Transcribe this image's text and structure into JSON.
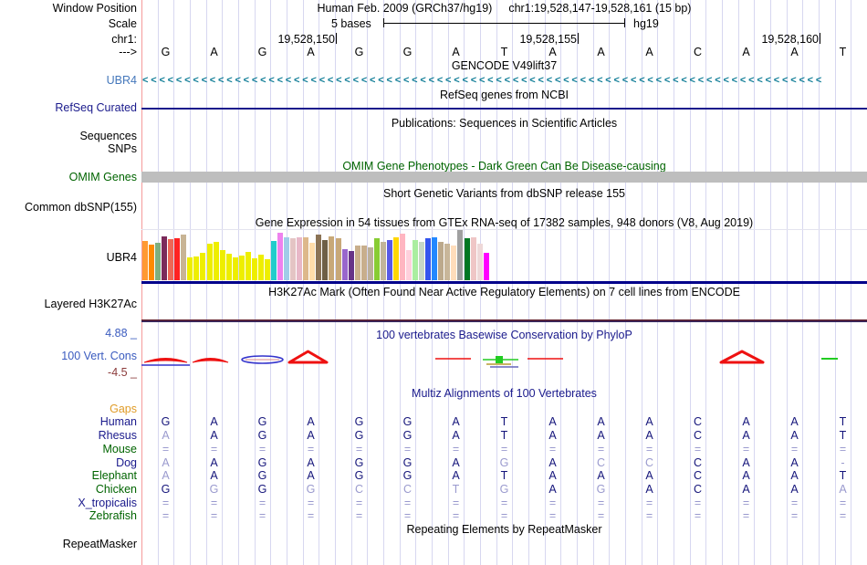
{
  "header": {
    "window_position_label": "Window Position",
    "assembly_title": "Human Feb. 2009 (GRCh37/hg19)",
    "position_title": "chr1:19,528,147-19,528,161 (15 bp)",
    "scale_label": "Scale",
    "scale_bar_text": "5 bases",
    "assembly_short": "hg19",
    "chrom_label": "chr1:",
    "strand_label": "--->",
    "coordinate_ticks": [
      "19,528,150",
      "19,528,155",
      "19,528,160"
    ],
    "sequence": [
      "G",
      "A",
      "G",
      "A",
      "G",
      "G",
      "A",
      "T",
      "A",
      "A",
      "A",
      "C",
      "A",
      "A",
      "T"
    ]
  },
  "tracks": {
    "gencode": {
      "title": "GENCODE V49lift37",
      "gene_label": "UBR4",
      "strand_direction": "left"
    },
    "refseq": {
      "title": "RefSeq genes from NCBI",
      "label": "RefSeq Curated"
    },
    "publications": {
      "title": "Publications: Sequences in Scientific Articles",
      "label_sequences": "Sequences",
      "label_snps": "SNPs"
    },
    "omim": {
      "title": "OMIM Gene Phenotypes - Dark Green Can Be Disease-causing",
      "label": "OMIM Genes"
    },
    "dbsnp": {
      "title": "Short Genetic Variants from dbSNP release 155",
      "label": "Common dbSNP(155)"
    },
    "gtex": {
      "title": "Gene Expression in 54 tissues from GTEx RNA-seq of 17382 samples, 948 donors (V8, Aug 2019)",
      "label": "UBR4"
    },
    "h3k27ac": {
      "title": "H3K27Ac Mark (Often Found Near Active Regulatory Elements) on 7 cell lines from ENCODE",
      "label": "Layered H3K27Ac"
    },
    "phylop": {
      "title": "100 vertebrates Basewise Conservation by PhyloP",
      "label": "100 Vert. Cons",
      "max_tick": "4.88 _",
      "min_tick": "-4.5 _"
    },
    "multiz": {
      "title": "Multiz Alignments of 100 Vertebrates"
    },
    "repeatmasker": {
      "title": "Repeating Elements by RepeatMasker",
      "label": "RepeatMasker"
    }
  },
  "colors": {
    "grid": "#d7d7f0",
    "guide_red": "#f59a9a",
    "gencode_arrows": "#0e7c96",
    "gene_label_blue": "#4477bb",
    "refseq_navy": "#1a1a8c",
    "omim_green": "#006400",
    "omim_bar_gray": "#bebebe",
    "gtex_baseline_navy": "#00008b",
    "h3k27ac_line_top": "#6e2020",
    "h3k27ac_line_bottom": "#28286e",
    "phylop_pos_red": "#ee1111",
    "phylop_neg_blue": "#3333cc",
    "phylop_green": "#22cc22",
    "aln_dark": "#15157b",
    "aln_dim": "#9a9ace",
    "gaps_orange": "#e09c28"
  },
  "chart_data": [
    {
      "type": "bar",
      "title": "Gene Expression in 54 tissues from GTEx RNA-seq of 17382 samples, 948 donors (V8, Aug 2019)",
      "series": "UBR4 expression per GTEx tissue (left to right as drawn)",
      "ylabel": "relative expression (bar height, 0-1 of panel)",
      "values": [
        0.78,
        0.71,
        0.75,
        0.87,
        0.82,
        0.84,
        0.91,
        0.45,
        0.47,
        0.55,
        0.73,
        0.76,
        0.6,
        0.53,
        0.45,
        0.49,
        0.56,
        0.44,
        0.51,
        0.42,
        0.78,
        0.95,
        0.85,
        0.84,
        0.85,
        0.85,
        0.75,
        0.91,
        0.8,
        0.87,
        0.84,
        0.62,
        0.58,
        0.69,
        0.69,
        0.65,
        0.84,
        0.76,
        0.8,
        0.85,
        0.93,
        0.6,
        0.8,
        0.76,
        0.84,
        0.85,
        0.76,
        0.73,
        0.69,
        1.0,
        0.84,
        0.85,
        0.73,
        0.55
      ],
      "colors": [
        "#ff9933",
        "#ff8a00",
        "#7faf7f",
        "#7b2b5b",
        "#ee6655",
        "#ff2222",
        "#c8b494",
        "#eeee00",
        "#eeee00",
        "#eeee00",
        "#eeee00",
        "#eeee00",
        "#eeee00",
        "#eeee00",
        "#eeee00",
        "#eeee00",
        "#eeee00",
        "#eeee00",
        "#eeee00",
        "#eeee00",
        "#22cccc",
        "#ee82ee",
        "#a0cce8",
        "#e4c4c4",
        "#e8b8c8",
        "#ddb88a",
        "#ffddaa",
        "#8b7355",
        "#6e5f46",
        "#c8a878",
        "#c8a878",
        "#9966cc",
        "#663388",
        "#c8ae8c",
        "#c8ae8c",
        "#bcb09a",
        "#88cc33",
        "#c2b49a",
        "#5959e6",
        "#ffd700",
        "#ffb6c1",
        "#ffd0dc",
        "#aaeea0",
        "#c6d8c6",
        "#3355ee",
        "#2288ff",
        "#bca98c",
        "#c8b69a",
        "#ffddbb",
        "#a0a0a0",
        "#007722",
        "#efc6c6",
        "#eed8d8",
        "#ff00ff"
      ]
    },
    {
      "type": "area",
      "title": "100 vertebrates Basewise Conservation by PhyloP",
      "ylim": [
        -4.5,
        4.88
      ],
      "features": [
        {
          "base": 1,
          "shape": "hump",
          "color": "red",
          "x1": 158,
          "x2": 205,
          "underline": "blue"
        },
        {
          "base": 2,
          "shape": "hump",
          "color": "red",
          "x1": 211,
          "x2": 250
        },
        {
          "base": 3,
          "shape": "ellipse",
          "color": "blue",
          "x1": 265,
          "x2": 310
        },
        {
          "base": 4,
          "shape": "triangle",
          "color": "red",
          "x1": 317,
          "x2": 358
        },
        {
          "base": 7,
          "shape": "line",
          "color": "red",
          "x1": 477,
          "x2": 516
        },
        {
          "base": 8,
          "shape": "line-with-box",
          "color": "green",
          "x1": 529,
          "x2": 568,
          "box_x": 543
        },
        {
          "base": 9,
          "shape": "line",
          "color": "red",
          "x1": 578,
          "x2": 617
        },
        {
          "base": 13,
          "shape": "triangle",
          "color": "red",
          "x1": 790,
          "x2": 836
        },
        {
          "base": 15,
          "shape": "dash",
          "color": "green",
          "x1": 900,
          "x2": 918
        }
      ]
    },
    {
      "type": "table",
      "title": "Multiz Alignments of 100 Vertebrates",
      "note": "lowercase = dimmed letter, '=' = unaligning double-dash, '-' = gap",
      "rows": [
        {
          "name": "Gaps",
          "name_color": "orange",
          "cells": ""
        },
        {
          "name": "Human",
          "name_color": "navy",
          "cells": "GAGAGGATAAACAAT"
        },
        {
          "name": "Rhesus",
          "name_color": "navy",
          "cells": "aAGAGGATAAACAAT"
        },
        {
          "name": "Mouse",
          "name_color": "green",
          "cells": "==============="
        },
        {
          "name": "Dog",
          "name_color": "navy",
          "cells": "aAGAGGAgAccCAA-"
        },
        {
          "name": "Elephant",
          "name_color": "green",
          "cells": "aAGAGGATAAACAAT"
        },
        {
          "name": "Chicken",
          "name_color": "green",
          "cells": "GgGgcctgAgACAAa"
        },
        {
          "name": "X_tropicalis",
          "name_color": "navy",
          "cells": "==============="
        },
        {
          "name": "Zebrafish",
          "name_color": "green",
          "cells": "==============="
        }
      ]
    }
  ]
}
